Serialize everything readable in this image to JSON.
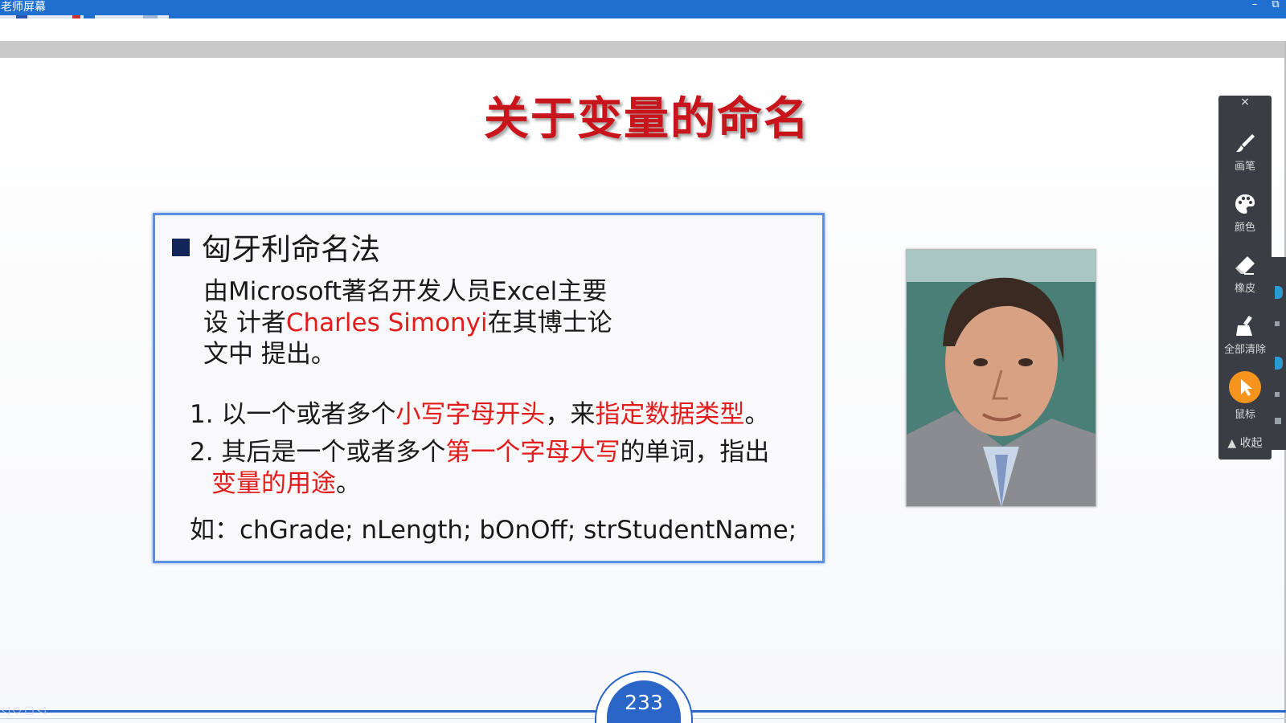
{
  "window": {
    "title": "老师屏幕",
    "minimize_glyph": "–",
    "restore_glyph": "⧉"
  },
  "slide": {
    "title": "关于变量的命名",
    "heading": "匈牙利命名法",
    "intro": {
      "line1": "由Microsoft著名开发人员Excel主要",
      "line2_pre": "设 计者",
      "line2_red": "Charles Simonyi",
      "line2_post": "在其博士论",
      "line3": "文中 提出。"
    },
    "rule1": {
      "pre": "1. 以一个或者多个",
      "red1": "小写字母开头",
      "mid": "，来",
      "red2": "指定数据类型",
      "post": "。"
    },
    "rule2": {
      "pre": "2. 其后是一个或者多个",
      "red1": "第一个字母大写",
      "mid": "的单词，指出",
      "red2": "变量的用途",
      "post": "。"
    },
    "example": "如：chGrade; nLength; bOnOff; strStudentName;",
    "page_number": "233"
  },
  "toolbar": {
    "close_glyph": "×",
    "tools": [
      {
        "label": "画笔",
        "icon": "brush-icon"
      },
      {
        "label": "颜色",
        "icon": "palette-icon"
      },
      {
        "label": "橡皮",
        "icon": "eraser-icon"
      },
      {
        "label": "全部清除",
        "icon": "clear-all-icon"
      },
      {
        "label": "鼠标",
        "icon": "mouse-pointer-icon"
      }
    ],
    "collapse_label": "▲ 收起"
  },
  "colors": {
    "titlebar": "#1e6fce",
    "slide_title": "#c8151b",
    "highlight_red": "#e21b1b",
    "frame_blue": "#5b8fe0",
    "toolbar_bg": "#3a3d44",
    "mouse_active": "#f6941d"
  }
}
